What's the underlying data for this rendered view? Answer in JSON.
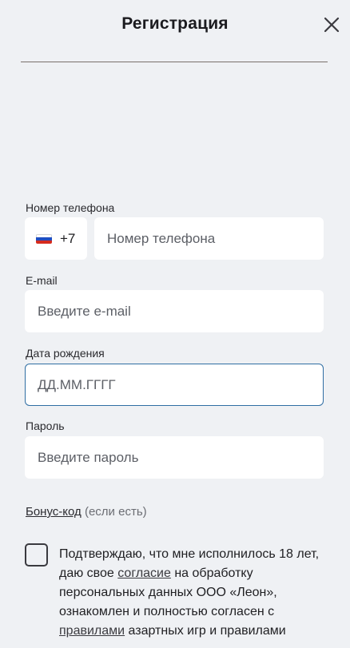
{
  "header": {
    "title": "Регистрация"
  },
  "phone": {
    "label": "Номер телефона",
    "country_code": "+7",
    "country_flag": "russia-flag-icon",
    "placeholder": "Номер телефона"
  },
  "email": {
    "label": "E-mail",
    "placeholder": "Введите e-mail"
  },
  "birthdate": {
    "label": "Дата рождения",
    "placeholder": "ДД.ММ.ГГГГ"
  },
  "password": {
    "label": "Пароль",
    "placeholder": "Введите пароль"
  },
  "bonus": {
    "link_label": "Бонус-код",
    "note": "(если есть)"
  },
  "consent": {
    "part1": "Подтверждаю, что мне исполнилось 18 лет, даю свое ",
    "link1": "согласие",
    "part2": " на обработку персональных данных ООО «Леон», ознакомлен и полностью согласен с ",
    "link2": "правилами",
    "part3": " азартных игр и правилами"
  },
  "colors": {
    "background": "#eff1f4",
    "focus_border": "#2f6ea3",
    "input_bg": "#ffffff"
  }
}
